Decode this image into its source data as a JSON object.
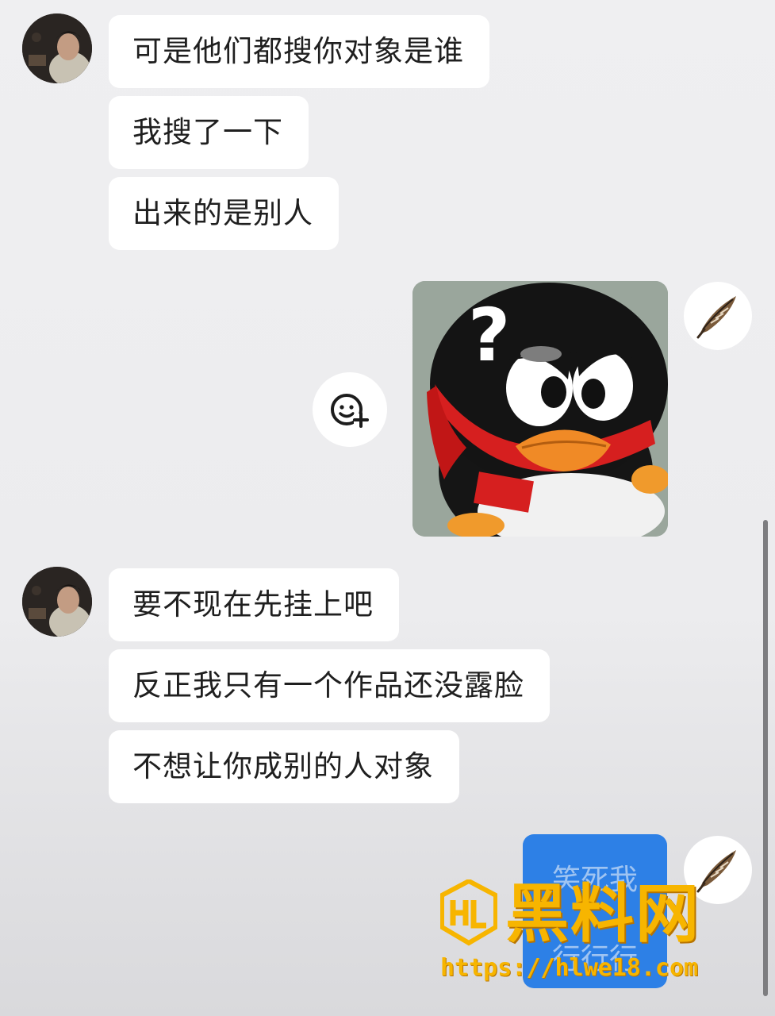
{
  "conversation": {
    "group1": {
      "messages": [
        "可是他们都搜你对象是谁",
        "我搜了一下",
        "出来的是别人"
      ]
    },
    "sticker": {
      "description_icon": "qq-penguin-question-sticker",
      "glyph": "?"
    },
    "group2": {
      "messages": [
        "要不现在先挂上吧",
        "反正我只有一个作品还没露脸",
        "不想让你成别的人对象"
      ]
    },
    "blue_card": {
      "line1": "笑死我",
      "line2": "行行行"
    }
  },
  "watermark": {
    "title": "黑料网",
    "url": "https://hlwe18.com",
    "logo_letters": "HL"
  },
  "icons": {
    "react_button": "add-emoji-icon",
    "my_avatar": "feather-icon"
  },
  "colors": {
    "bubble_bg": "#ffffff",
    "page_bg": "#efeff1",
    "card_blue": "#2d80e6",
    "watermark_gold": "#f7b500"
  }
}
